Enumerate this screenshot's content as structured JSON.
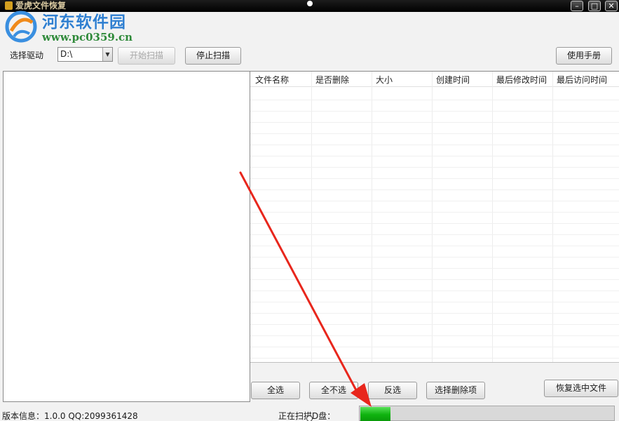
{
  "window": {
    "title": "爱虎文件恢复",
    "minimize_glyph": "–",
    "maximize_glyph": "□",
    "close_glyph": "✕"
  },
  "watermark": {
    "title": "河东软件园",
    "url": "www.pc0359.cn"
  },
  "toolbar": {
    "drive_label": "选择驱动",
    "drive_value": "D:\\",
    "start_scan": "开始扫描",
    "stop_scan": "停止扫描",
    "manual": "使用手册"
  },
  "file_list": {
    "columns": [
      "文件名称",
      "是否删除",
      "大小",
      "创建时间",
      "最后修改时间",
      "最后访问时间"
    ],
    "rows": []
  },
  "actions": {
    "select_all": "全选",
    "select_none": "全不选",
    "invert": "反选",
    "select_deleted": "选择删除项",
    "recover": "恢复选中文件"
  },
  "status": {
    "version": "版本信息：1.0.0 QQ:2099361428",
    "scanning": "正在扫描D盘：",
    "progress_fraction": 0.12
  },
  "colors": {
    "annotation_arrow": "#e8261c",
    "progress_green": "#0fb30f"
  }
}
